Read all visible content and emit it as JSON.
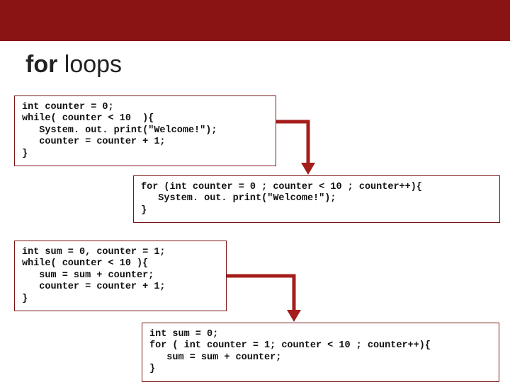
{
  "title": {
    "bold": "for",
    "thin": " loops"
  },
  "box1": "int counter = 0;\nwhile( counter < 10  ){\n   System. out. print(\"Welcome!\");\n   counter = counter + 1;\n}",
  "box2": "for (int counter = 0 ; counter < 10 ; counter++){\n   System. out. print(\"Welcome!\");\n}",
  "box3": "int sum = 0, counter = 1;\nwhile( counter < 10 ){\n   sum = sum + counter;\n   counter = counter + 1;\n}",
  "box4": "int sum = 0;\nfor ( int counter = 1; counter < 10 ; counter++){\n   sum = sum + counter;\n}",
  "colors": {
    "accent": "#8a1414",
    "arrow": "#a51c1c"
  }
}
